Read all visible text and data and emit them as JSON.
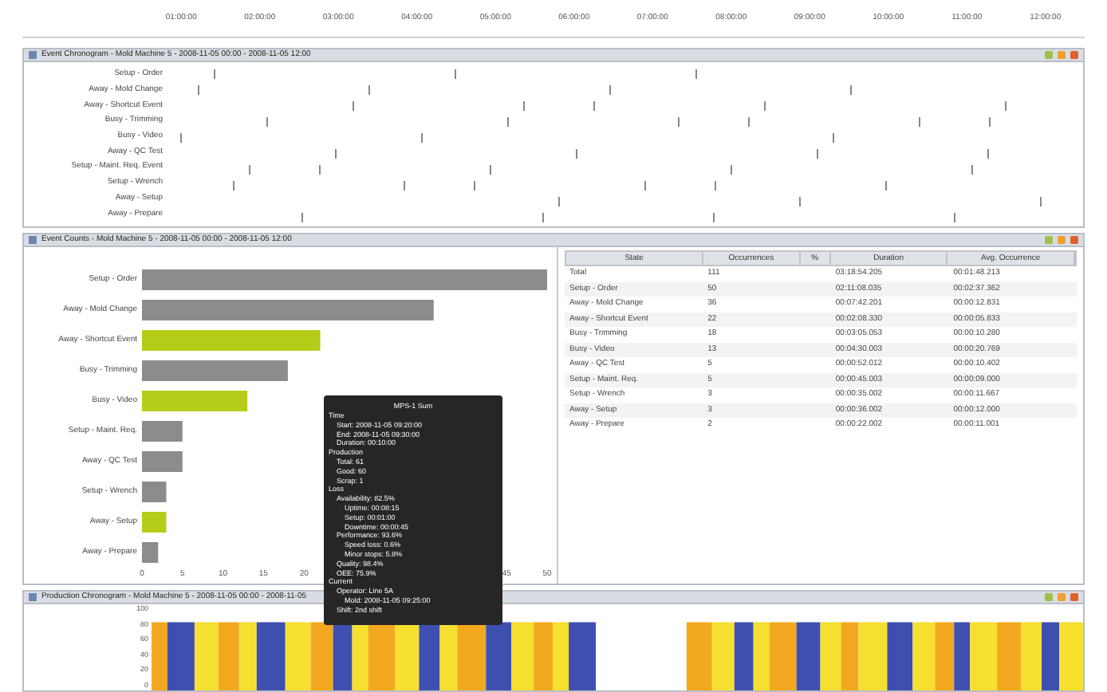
{
  "time_axis": {
    "ticks": [
      "01:00:00",
      "02:00:00",
      "03:00:00",
      "04:00:00",
      "05:00:00",
      "06:00:00",
      "07:00:00",
      "08:00:00",
      "09:00:00",
      "10:00:00",
      "11:00:00",
      "12:00:00"
    ]
  },
  "chronogram": {
    "title": "Event Chronogram - Mold Machine 5 - 2008-11-05 00:00 - 2008-11-05 12:00",
    "rows": [
      "Setup - Order",
      "Away - Mold Change",
      "Away - Shortcut Event",
      "Busy - Trimming",
      "Busy - Video",
      "Away - QC Test",
      "Setup - Maint. Req. Event",
      "Setup - Wrench",
      "Away - Setup",
      "Away - Prepare"
    ]
  },
  "counts_panel": {
    "title": "Event Counts - Mold Machine 5 - 2008-11-05 00:00 - 2008-11-05 12:00",
    "chart_data": {
      "type": "bar",
      "orientation": "horizontal",
      "stacked": true,
      "categories": [
        "Setup - Order",
        "Away - Mold Change",
        "Away - Shortcut Event",
        "Busy - Trimming",
        "Busy - Video",
        "Setup - Maint. Req.",
        "Away - QC Test",
        "Setup - Wrench",
        "Away - Setup",
        "Away - Prepare"
      ],
      "series": [
        {
          "color": "#8c8c8c",
          "values": [
            50,
            36,
            null,
            18,
            null,
            5,
            5,
            3,
            null,
            2
          ]
        },
        {
          "color": "#b5cc18",
          "values": [
            null,
            null,
            22,
            null,
            13,
            null,
            null,
            null,
            3,
            null
          ]
        }
      ],
      "xlim": [
        0,
        50
      ],
      "xticks": [
        0,
        5,
        10,
        15,
        20,
        45,
        50
      ]
    },
    "table": {
      "columns": [
        "State",
        "Occurrences",
        "%",
        "Duration",
        "Avg. Occurrence"
      ],
      "rows": [
        [
          "Total",
          "111",
          "",
          "03:18:54.205",
          "00:01:48.213"
        ],
        [
          "Setup - Order",
          "50",
          "",
          "02:11:08.035",
          "00:02:37.362"
        ],
        [
          "Away - Mold Change",
          "36",
          "",
          "00:07:42.201",
          "00:00:12.831"
        ],
        [
          "Away - Shortcut Event",
          "22",
          "",
          "00:02:08.330",
          "00:00:05.833"
        ],
        [
          "Busy - Trimming",
          "18",
          "",
          "00:03:05.053",
          "00:00:10.280"
        ],
        [
          "Busy - Video",
          "13",
          "",
          "00:04:30.003",
          "00:00:20.769"
        ],
        [
          "Away - QC Test",
          "5",
          "",
          "00:00:52.012",
          "00:00:10.402"
        ],
        [
          "Setup - Maint. Req.",
          "5",
          "",
          "00:00:45.003",
          "00:00:09.000"
        ],
        [
          "Setup - Wrench",
          "3",
          "",
          "00:00:35.002",
          "00:00:11.667"
        ],
        [
          "Away - Setup",
          "3",
          "",
          "00:00:36.002",
          "00:00:12.000"
        ],
        [
          "Away - Prepare",
          "2",
          "",
          "00:00:22.002",
          "00:00:11.001"
        ]
      ]
    }
  },
  "tooltip": {
    "title": "MPS-1 Sum",
    "sections": [
      {
        "text": "Time",
        "children": [
          {
            "text": "Start: 2008-11-05 09:20:00"
          },
          {
            "text": "End: 2008-11-05 09:30:00"
          },
          {
            "text": "Duration: 00:10:00"
          }
        ]
      },
      {
        "text": "Production",
        "children": [
          {
            "text": "Total: 61"
          },
          {
            "text": "Good: 60"
          },
          {
            "text": "Scrap: 1"
          }
        ]
      },
      {
        "text": "Loss",
        "children": [
          {
            "text": "Availability: 82.5%",
            "children": [
              {
                "text": "Uptime: 00:08:15"
              },
              {
                "text": "Setup: 00:01:00"
              },
              {
                "text": "Downtime: 00:00:45"
              }
            ]
          },
          {
            "text": "Performance: 93.6%",
            "children": [
              {
                "text": "Speed loss: 0.6%"
              },
              {
                "text": "Minor stops: 5.8%"
              }
            ]
          },
          {
            "text": "Quality: 98.4%"
          },
          {
            "text": "OEE: 75.9%"
          }
        ]
      },
      {
        "text": "Current",
        "children": [
          {
            "text": "Operator: Line 5A",
            "children": [
              {
                "text": "Mold: 2008-11-05 09:25:00"
              }
            ]
          },
          {
            "text": "Shift: 2nd shift"
          }
        ]
      }
    ]
  },
  "histogram_panel": {
    "title": "Production Chronogram - Mold Machine 5 - 2008-11-05 00:00 - 2008-11-05",
    "y_ticks": [
      "100",
      "80",
      "60",
      "40",
      "20",
      "0"
    ]
  }
}
